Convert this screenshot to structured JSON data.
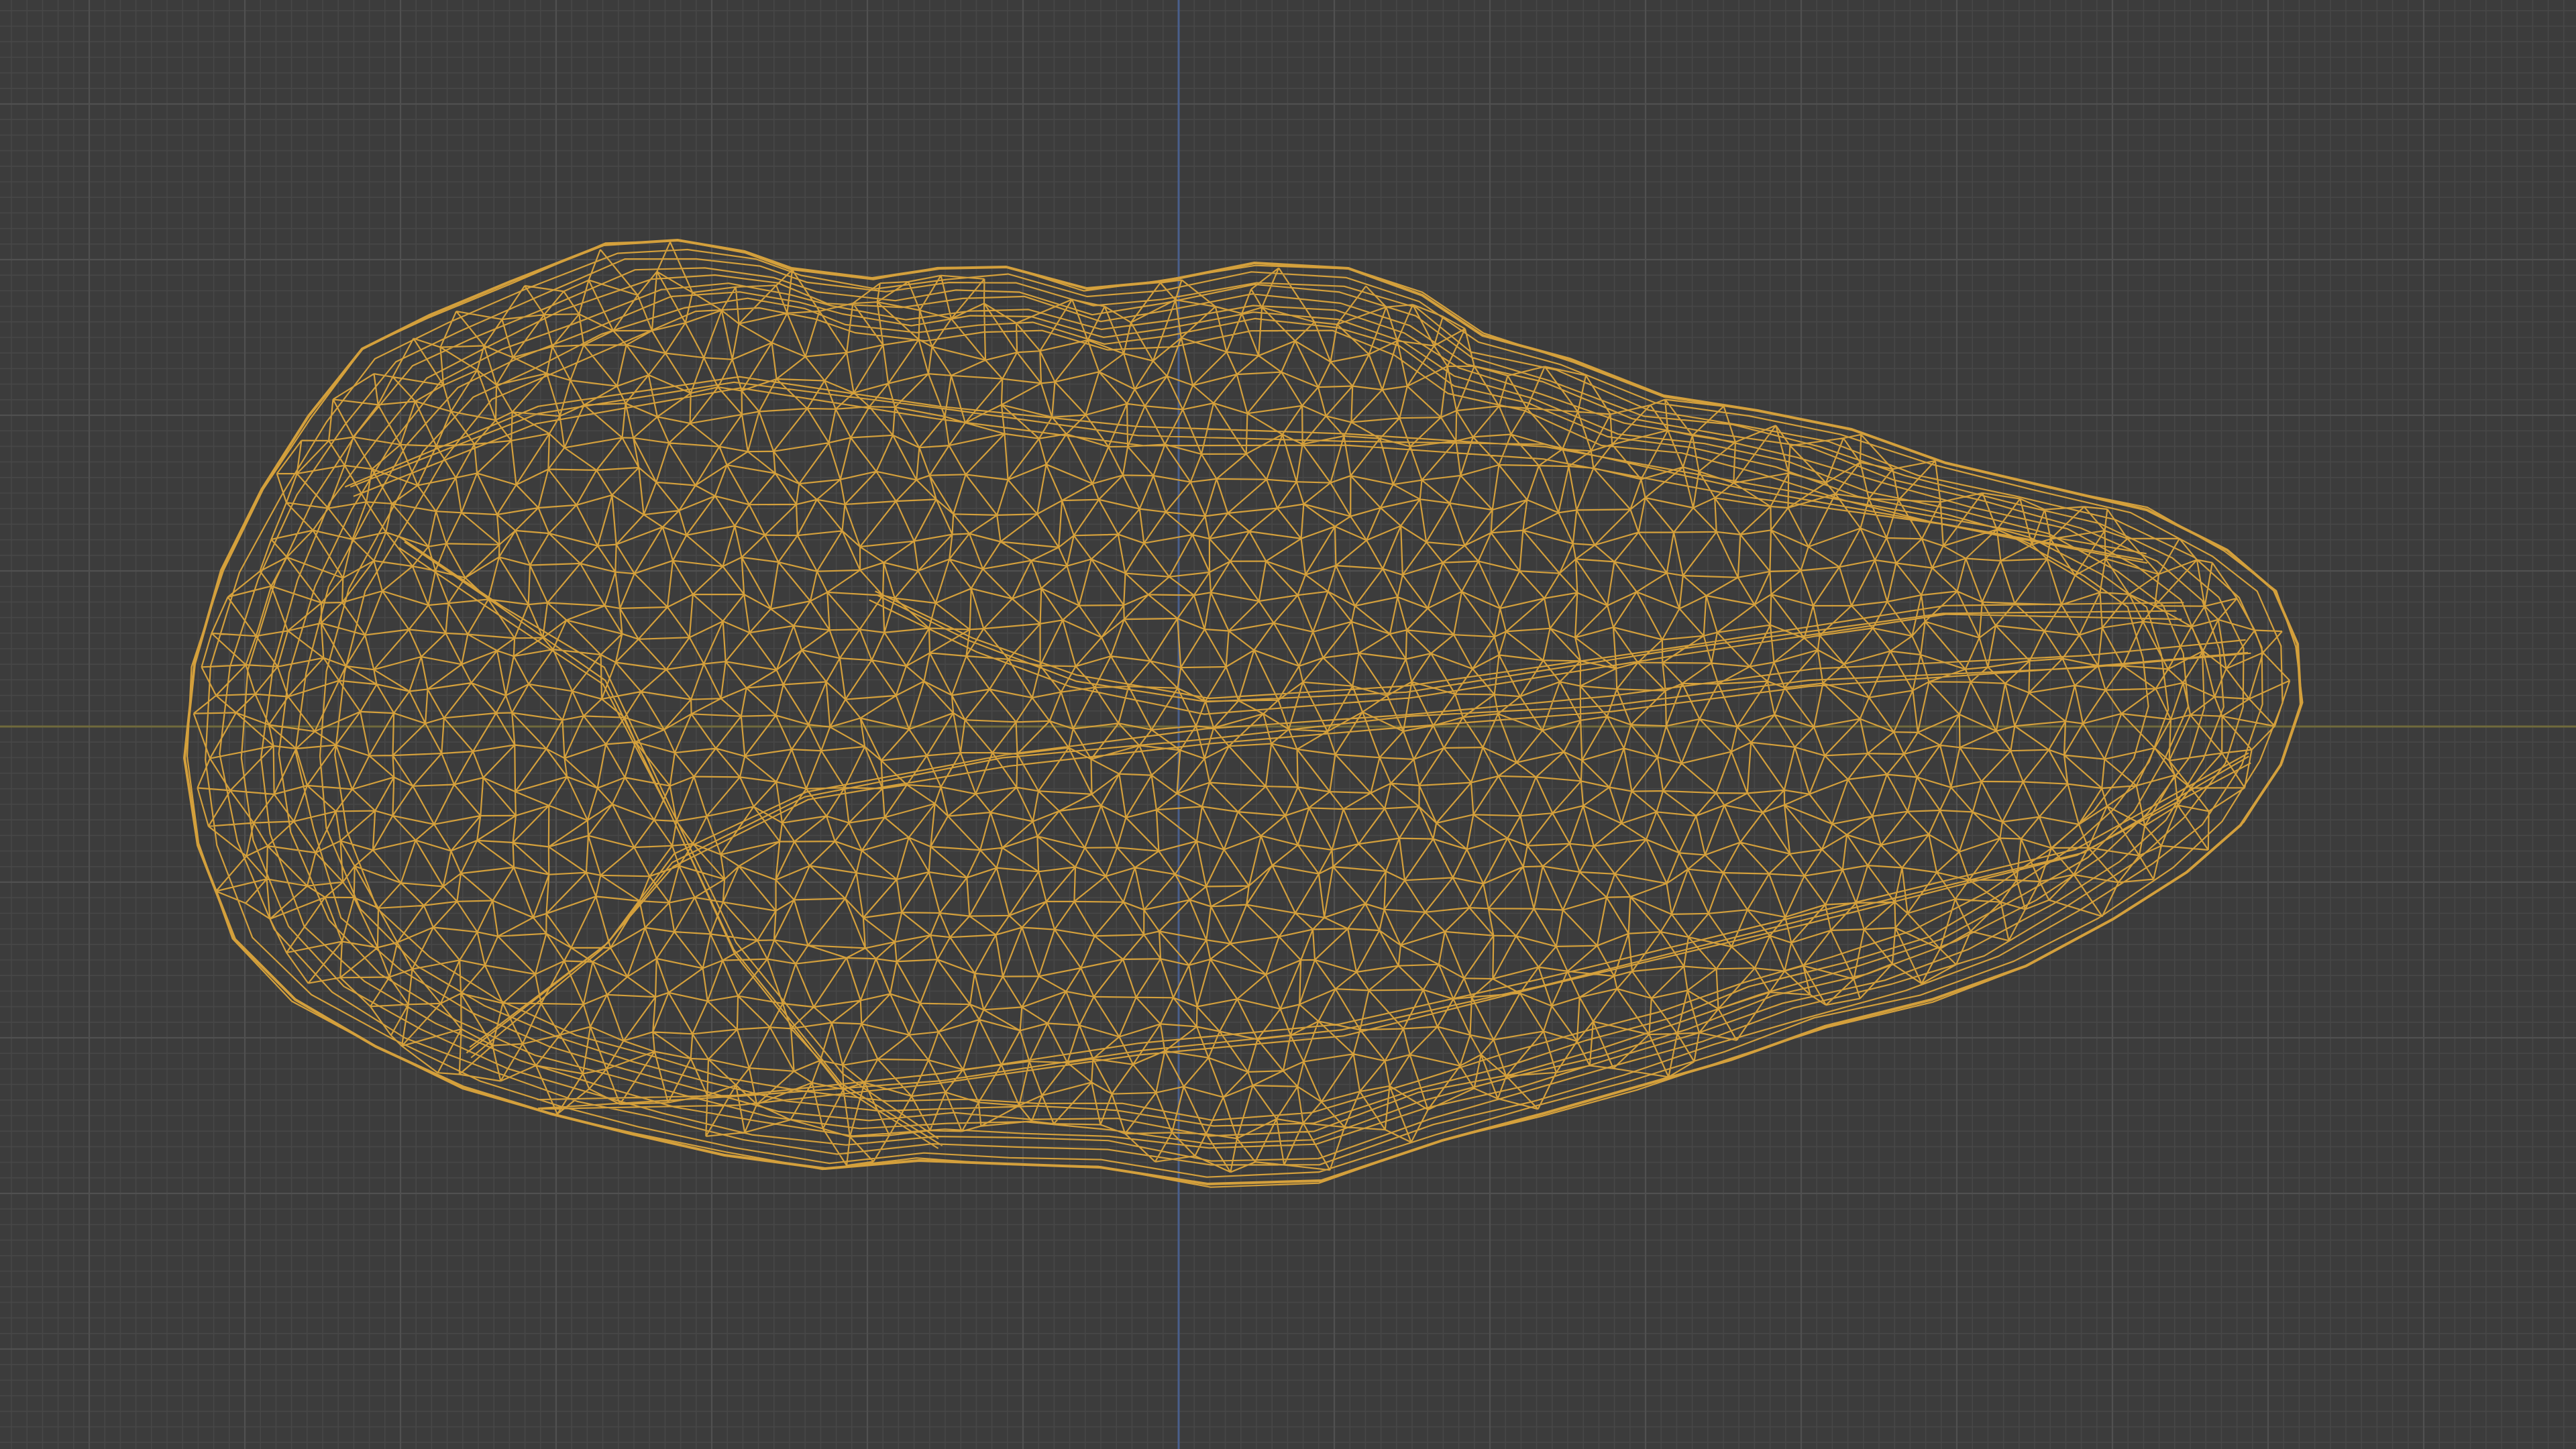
{
  "viewport": {
    "view": "3d-viewport-wireframe",
    "background_color": "#3c3c3c",
    "grid_minor_color": "#474747",
    "grid_major_color": "#505050",
    "x_axis_color": "#6f6a3c",
    "z_axis_color": "#4a5f8c",
    "wire_color": "#d4a03c"
  },
  "object": {
    "name": "rock-mesh",
    "display": "wireframe",
    "selected": true
  }
}
